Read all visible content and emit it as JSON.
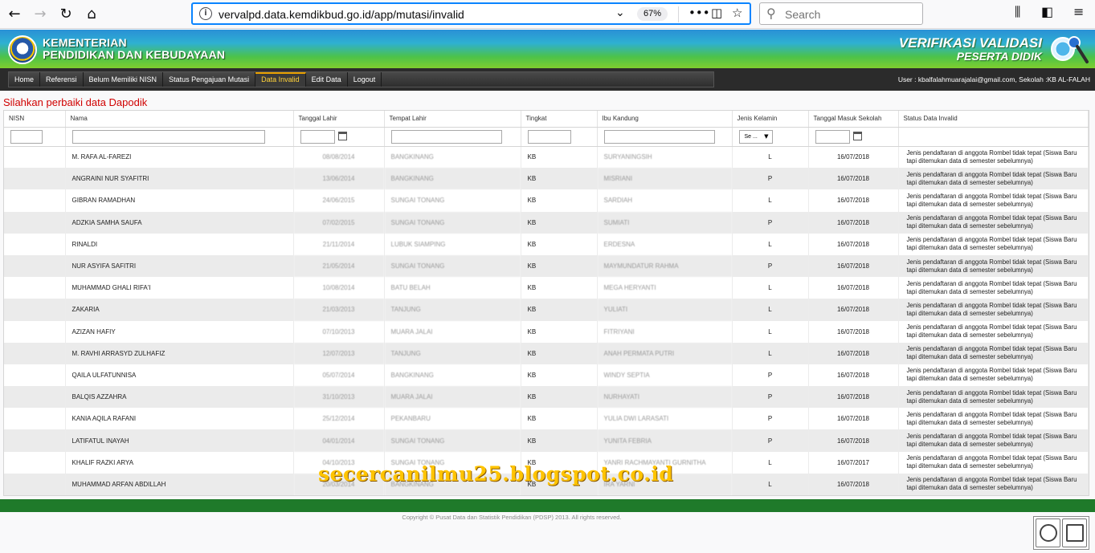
{
  "browser": {
    "url": "vervalpd.data.kemdikbud.go.id/app/mutasi/invalid",
    "zoom": "67%",
    "search_placeholder": "Search"
  },
  "header": {
    "ministry_line1": "KEMENTERIAN",
    "ministry_line2": "PENDIDIKAN DAN KEBUDAYAAN",
    "app_line1": "VERIFIKASI VALIDASI",
    "app_line2": "PESERTA DIDIK"
  },
  "menu": {
    "items": [
      "Home",
      "Referensi",
      "Belum Memiliki NISN",
      "Status Pengajuan Mutasi",
      "Data Invalid",
      "Edit Data",
      "Logout"
    ],
    "active_index": 4,
    "user_info": "User : kbalfalahmuarajalai@gmail.com, Sekolah :KB AL-FALAH"
  },
  "page": {
    "title": "Silahkan perbaiki data Dapodik"
  },
  "table": {
    "columns": [
      "NISN",
      "Nama",
      "Tanggal Lahir",
      "Tempat Lahir",
      "Tingkat",
      "Ibu Kandung",
      "Jenis Kelamin",
      "Tanggal Masuk Sekolah",
      "Status Data Invalid"
    ],
    "gender_filter": "Se ...",
    "status_text": "Jenis pendaftaran di anggota Rombel tidak tepat (Siswa Baru tapi ditemukan data di semester sebelumnya)",
    "rows": [
      {
        "nisn": "",
        "nama": "M. RAFA AL-FAREZI",
        "tgl_lahir": "08/08/2014",
        "tempat": "BANGKINANG",
        "tingkat": "KB",
        "ibu": "SURYANINGSIH",
        "jk": "L",
        "tgl_masuk": "16/07/2018"
      },
      {
        "nisn": "",
        "nama": "ANGRAINI NUR SYAFITRI",
        "tgl_lahir": "13/06/2014",
        "tempat": "BANGKINANG",
        "tingkat": "KB",
        "ibu": "MISRIANI",
        "jk": "P",
        "tgl_masuk": "16/07/2018"
      },
      {
        "nisn": "",
        "nama": "GIBRAN RAMADHAN",
        "tgl_lahir": "24/06/2015",
        "tempat": "SUNGAI TONANG",
        "tingkat": "KB",
        "ibu": "SARDIAH",
        "jk": "L",
        "tgl_masuk": "16/07/2018"
      },
      {
        "nisn": "",
        "nama": "ADZKIA SAMHA SAUFA",
        "tgl_lahir": "07/02/2015",
        "tempat": "SUNGAI TONANG",
        "tingkat": "KB",
        "ibu": "SUMIATI",
        "jk": "P",
        "tgl_masuk": "16/07/2018"
      },
      {
        "nisn": "",
        "nama": "RINALDI",
        "tgl_lahir": "21/11/2014",
        "tempat": "LUBUK SIAMPING",
        "tingkat": "KB",
        "ibu": "ERDESNA",
        "jk": "L",
        "tgl_masuk": "16/07/2018"
      },
      {
        "nisn": "",
        "nama": "NUR ASYIFA SAFITRI",
        "tgl_lahir": "21/05/2014",
        "tempat": "SUNGAI TONANG",
        "tingkat": "KB",
        "ibu": "MAYMUNDATUR RAHMA",
        "jk": "P",
        "tgl_masuk": "16/07/2018"
      },
      {
        "nisn": "",
        "nama": "MUHAMMAD GHALI RIFA'I",
        "tgl_lahir": "10/08/2014",
        "tempat": "BATU BELAH",
        "tingkat": "KB",
        "ibu": "MEGA HERYANTI",
        "jk": "L",
        "tgl_masuk": "16/07/2018"
      },
      {
        "nisn": "",
        "nama": "ZAKARIA",
        "tgl_lahir": "21/03/2013",
        "tempat": "TANJUNG",
        "tingkat": "KB",
        "ibu": "YULIATI",
        "jk": "L",
        "tgl_masuk": "16/07/2018"
      },
      {
        "nisn": "",
        "nama": "AZIZAN HAFIY",
        "tgl_lahir": "07/10/2013",
        "tempat": "MUARA JALAI",
        "tingkat": "KB",
        "ibu": "FITRIYANI",
        "jk": "L",
        "tgl_masuk": "16/07/2018"
      },
      {
        "nisn": "",
        "nama": "M. RAVHI ARRASYD ZULHAFIZ",
        "tgl_lahir": "12/07/2013",
        "tempat": "TANJUNG",
        "tingkat": "KB",
        "ibu": "ANAH PERMATA PUTRI",
        "jk": "L",
        "tgl_masuk": "16/07/2018"
      },
      {
        "nisn": "",
        "nama": "QAILA ULFATUNNISA",
        "tgl_lahir": "05/07/2014",
        "tempat": "BANGKINANG",
        "tingkat": "KB",
        "ibu": "WINDY SEPTIA",
        "jk": "P",
        "tgl_masuk": "16/07/2018"
      },
      {
        "nisn": "",
        "nama": "BALQIS AZZAHRA",
        "tgl_lahir": "31/10/2013",
        "tempat": "MUARA JALAI",
        "tingkat": "KB",
        "ibu": "NURHAYATI",
        "jk": "P",
        "tgl_masuk": "16/07/2018"
      },
      {
        "nisn": "",
        "nama": "KANIA AQILA RAFANI",
        "tgl_lahir": "25/12/2014",
        "tempat": "PEKANBARU",
        "tingkat": "KB",
        "ibu": "YULIA DWI LARASATI",
        "jk": "P",
        "tgl_masuk": "16/07/2018"
      },
      {
        "nisn": "",
        "nama": "LATIFATUL INAYAH",
        "tgl_lahir": "04/01/2014",
        "tempat": "SUNGAI TONANG",
        "tingkat": "KB",
        "ibu": "YUNITA FEBRIA",
        "jk": "P",
        "tgl_masuk": "16/07/2018"
      },
      {
        "nisn": "",
        "nama": "KHALIF RAZKI ARYA",
        "tgl_lahir": "04/10/2013",
        "tempat": "SUNGAI TONANG",
        "tingkat": "KB",
        "ibu": "YANRI RACHMAYANTI GURNITHA",
        "jk": "L",
        "tgl_masuk": "16/07/2017"
      },
      {
        "nisn": "",
        "nama": "MUHAMMAD ARFAN ABDILLAH",
        "tgl_lahir": "20/03/2014",
        "tempat": "BANGKINANG",
        "tingkat": "KB",
        "ibu": "IRA YARNI",
        "jk": "L",
        "tgl_masuk": "16/07/2018"
      }
    ]
  },
  "watermark": "secercanilmu25.blogspot.co.id",
  "footer": {
    "copyright": "Copyright © Pusat Data dan Statistik Pendidikan (PDSP) 2013. All rights reserved."
  }
}
